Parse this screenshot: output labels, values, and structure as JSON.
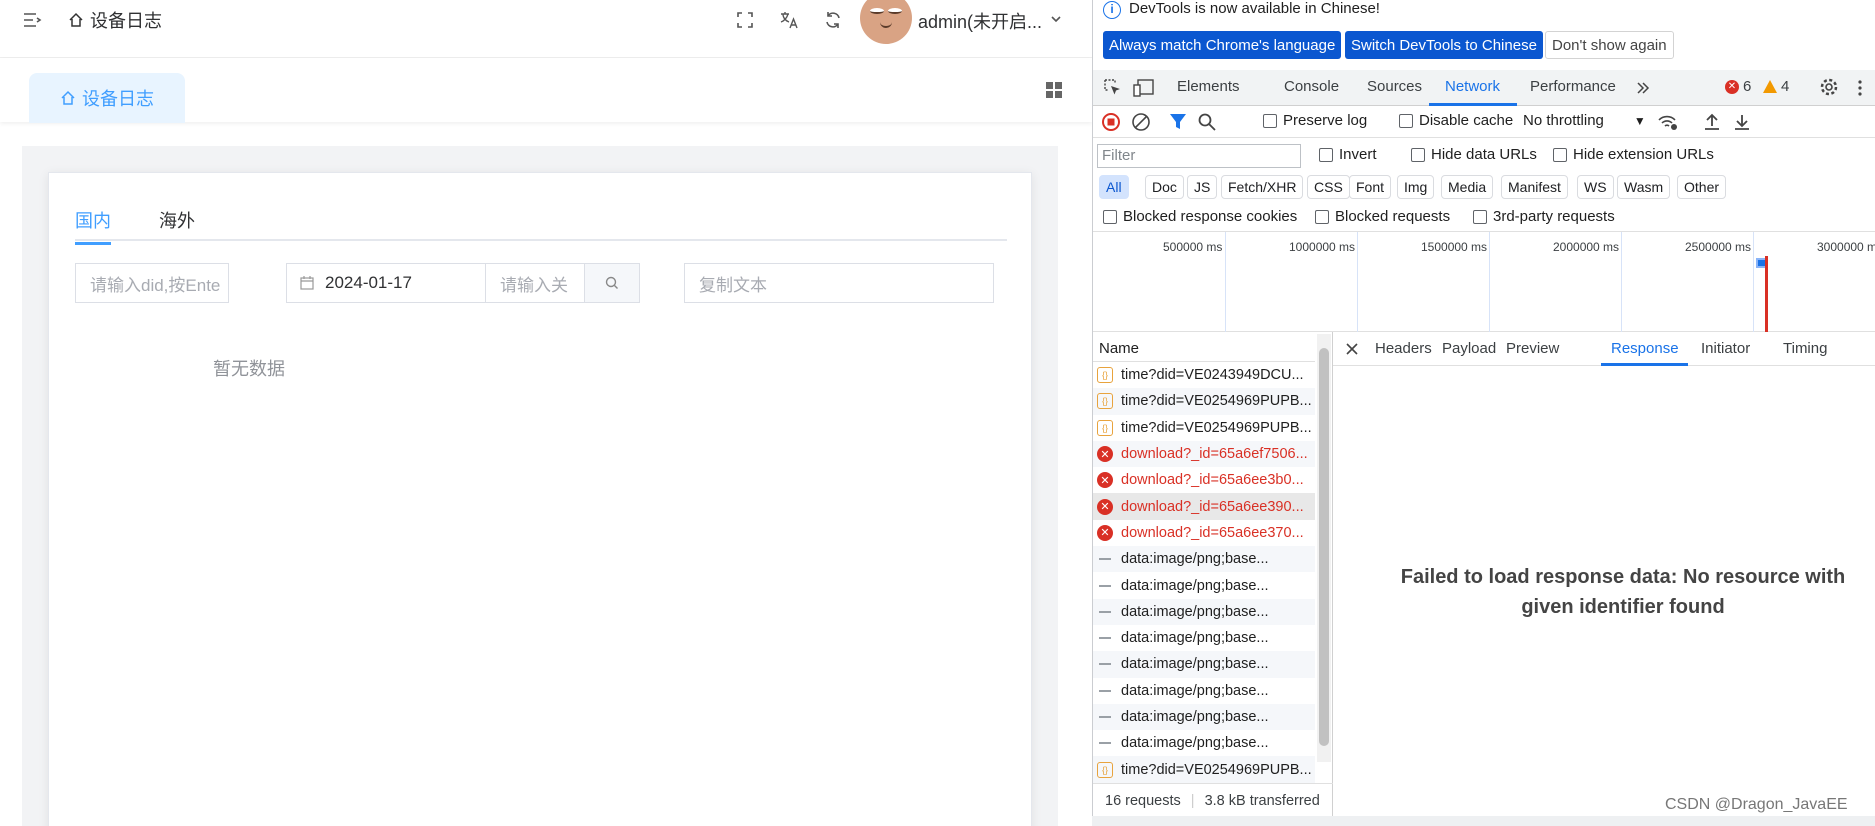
{
  "app": {
    "breadcrumb": "设备日志",
    "user": "admin(未开启...",
    "view_tab": "设备日志",
    "region_tabs": [
      "国内",
      "海外"
    ],
    "did_placeholder": "请输入did,按Ente",
    "date_value": "2024-01-17",
    "keyword_placeholder": "请输入关",
    "copy_placeholder": "复制文本",
    "empty_text": "暂无数据"
  },
  "devtools": {
    "info": "DevTools is now available in Chinese!",
    "btn_match": "Always match Chrome's language",
    "btn_switch": "Switch DevTools to Chinese",
    "btn_dismiss": "Don't show again",
    "tabs": [
      "Elements",
      "Console",
      "Sources",
      "Network",
      "Performance"
    ],
    "active_tab": "Network",
    "errors": "6",
    "warnings": "4",
    "toolbar": {
      "preserve_log": "Preserve log",
      "disable_cache": "Disable cache",
      "throttling": "No throttling"
    },
    "filter_placeholder": "Filter",
    "invert": "Invert",
    "hide_data_urls": "Hide data URLs",
    "hide_ext_urls": "Hide extension URLs",
    "types": [
      "All",
      "Doc",
      "JS",
      "Fetch/XHR",
      "CSS",
      "Font",
      "Img",
      "Media",
      "Manifest",
      "WS",
      "Wasm",
      "Other"
    ],
    "blocked_cookies": "Blocked response cookies",
    "blocked_requests": "Blocked requests",
    "third_party": "3rd-party requests",
    "timeline_labels": [
      "500000 ms",
      "1000000 ms",
      "1500000 ms",
      "2000000 ms",
      "2500000 ms",
      "3000000 ms"
    ],
    "name_header": "Name",
    "requests": [
      {
        "name": "time?did=VE0243949DCU...",
        "kind": "xhr"
      },
      {
        "name": "time?did=VE0254969PUPB...",
        "kind": "xhr"
      },
      {
        "name": "time?did=VE0254969PUPB...",
        "kind": "xhr"
      },
      {
        "name": "download?_id=65a6ef7506...",
        "kind": "err"
      },
      {
        "name": "download?_id=65a6ee3b0...",
        "kind": "err"
      },
      {
        "name": "download?_id=65a6ee390...",
        "kind": "err"
      },
      {
        "name": "download?_id=65a6ee370...",
        "kind": "err"
      },
      {
        "name": "data:image/png;base...",
        "kind": "img"
      },
      {
        "name": "data:image/png;base...",
        "kind": "img"
      },
      {
        "name": "data:image/png;base...",
        "kind": "img"
      },
      {
        "name": "data:image/png;base...",
        "kind": "img"
      },
      {
        "name": "data:image/png;base...",
        "kind": "img"
      },
      {
        "name": "data:image/png;base...",
        "kind": "img"
      },
      {
        "name": "data:image/png;base...",
        "kind": "img"
      },
      {
        "name": "data:image/png;base...",
        "kind": "img"
      },
      {
        "name": "time?did=VE0254969PUPB...",
        "kind": "xhr"
      }
    ],
    "footer_requests": "16 requests",
    "footer_transferred": "3.8 kB transferred",
    "detail_tabs": [
      "Headers",
      "Payload",
      "Preview",
      "Response",
      "Initiator",
      "Timing"
    ],
    "active_detail_tab": "Response",
    "detail_message": "Failed to load response data: No resource with given identifier found"
  },
  "watermark": "CSDN @Dragon_JavaEE"
}
